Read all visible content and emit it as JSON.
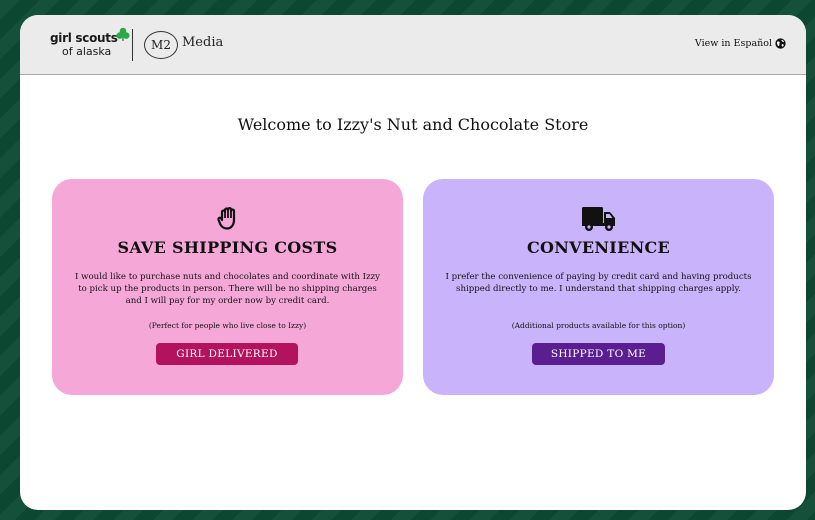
{
  "header": {
    "gs_logo": {
      "line1": "girl scouts",
      "line2": "of alaska",
      "icon": "trefoil-icon",
      "trefoil_color": "#2aa84a"
    },
    "m2_logo": {
      "mark": "M2",
      "text": "Media"
    },
    "language_link": {
      "label": "View in Español",
      "icon": "globe-icon"
    }
  },
  "main": {
    "title": "Welcome to Izzy's Nut and Chocolate Store",
    "options": [
      {
        "icon": "raised-hand-icon",
        "heading": "SAVE SHIPPING COSTS",
        "body": "I would like to purchase nuts and chocolates and coordinate with Izzy to pick up the products in person. There will be no shipping charges and I will pay for my order now by credit card.",
        "note": "(Perfect for people who live close to Izzy)",
        "button_label": "GIRL DELIVERED",
        "card_color": "#f5a8d8",
        "button_color": "#b3135e"
      },
      {
        "icon": "delivery-truck-icon",
        "heading": "CONVENIENCE",
        "body": "I prefer the convenience of paying by credit card and having products shipped directly to me. I understand that shipping charges apply.",
        "note": "(Additional products available for this option)",
        "button_label": "SHIPPED TO ME",
        "card_color": "#c9b3fb",
        "button_color": "#5b1e91"
      }
    ]
  }
}
